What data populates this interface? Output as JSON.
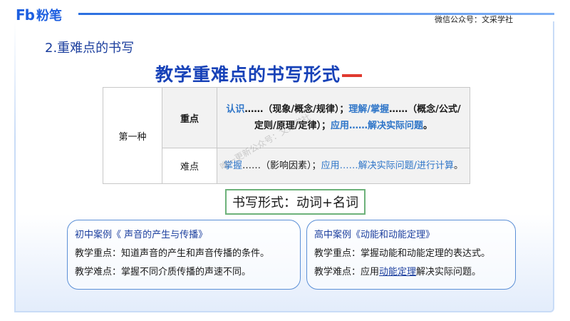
{
  "header": {
    "logo_mark": "Fb",
    "logo_text": "粉笔",
    "wechat": "微信公众号：文采学社"
  },
  "section_title": "2.重难点的书写",
  "main_title": "教学重难点的书写形式",
  "table": {
    "method": "第一种",
    "rows": [
      {
        "type": "重点",
        "parts": [
          {
            "text": "认识",
            "blue": true
          },
          {
            "text": "……（现象/概念/规律）；",
            "blue": false
          },
          {
            "text": "理解/掌握",
            "blue": true
          },
          {
            "text": "……（概念/公式/定则/原理/定律）；",
            "blue": false
          },
          {
            "text": "应用……解决实际问题",
            "blue": true
          },
          {
            "text": "。",
            "blue": false
          }
        ]
      },
      {
        "type": "难点",
        "parts": [
          {
            "text": "掌握",
            "blue": true
          },
          {
            "text": "……（影响因素）；",
            "blue": false
          },
          {
            "text": "应用……解决实际问题/进行计算",
            "blue": true
          },
          {
            "text": "。",
            "blue": false
          }
        ]
      }
    ]
  },
  "form": "书写形式：动词+名词",
  "cases": [
    {
      "title": "初中案例《 声音的产生与传播》",
      "key_label": "教学重点：",
      "key_text": "知道声音的产生和声音传播的条件。",
      "diff_label": "教学难点：",
      "diff_text": "掌握不同介质传播的声速不同。"
    },
    {
      "title": "高中案例《动能和动能定理》",
      "key_label": "教学重点：",
      "key_text": "掌握动能和动能定理的表达式。",
      "diff_label": "教学难点：",
      "diff_pre": "应用",
      "diff_under": "动能定理",
      "diff_post": "解决实际问题。"
    }
  ],
  "watermark": "唯一更新公众号：文采学社",
  "colors": {
    "brand": "#1d5fe0",
    "title": "#1742b8",
    "accent_dash": "#e03a2f",
    "highlight": "#2e75c8",
    "form_border": "#6db27a",
    "card_border": "#5b8fd6"
  }
}
